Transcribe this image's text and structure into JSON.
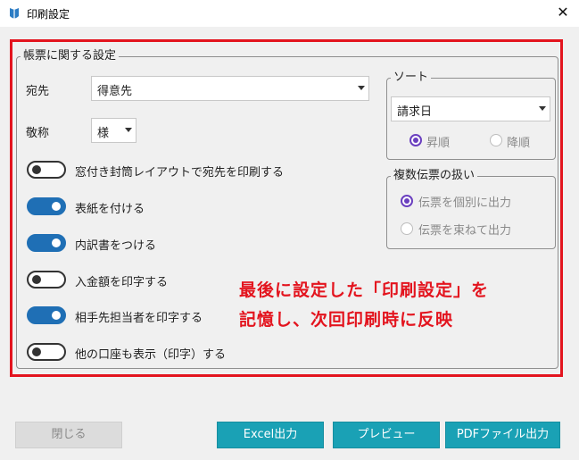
{
  "window": {
    "title": "印刷設定",
    "close_glyph": "✕"
  },
  "form": {
    "group_title": "帳票に関する設定",
    "recipient_label": "宛先",
    "recipient_value": "得意先",
    "honorific_label": "敬称",
    "honorific_value": "様",
    "toggles": [
      {
        "label": "窓付き封筒レイアウトで宛先を印刷する",
        "on": false
      },
      {
        "label": "表紙を付ける",
        "on": true
      },
      {
        "label": "内訳書をつける",
        "on": true
      },
      {
        "label": "入金額を印字する",
        "on": false
      },
      {
        "label": "相手先担当者を印字する",
        "on": true
      },
      {
        "label": "他の口座も表示（印字）する",
        "on": false
      }
    ]
  },
  "sort": {
    "title": "ソート",
    "value": "請求日",
    "options": [
      {
        "label": "昇順",
        "selected": true
      },
      {
        "label": "降順",
        "selected": false
      }
    ]
  },
  "multi": {
    "title": "複数伝票の扱い",
    "options": [
      {
        "label": "伝票を個別に出力",
        "selected": true
      },
      {
        "label": "伝票を束ねて出力",
        "selected": false
      }
    ]
  },
  "annotation": {
    "line1": "最後に設定した「印刷設定」を",
    "line2": "記憶し、次回印刷時に反映"
  },
  "buttons": {
    "close": "閉じる",
    "excel": "Excel出力",
    "preview": "プレビュー",
    "pdf": "PDFファイル出力"
  },
  "colors": {
    "highlight_red": "#e3141e",
    "toggle_on": "#1f6fb5",
    "radio_selected": "#6a3fbf",
    "button_primary": "#1aa1b5"
  }
}
